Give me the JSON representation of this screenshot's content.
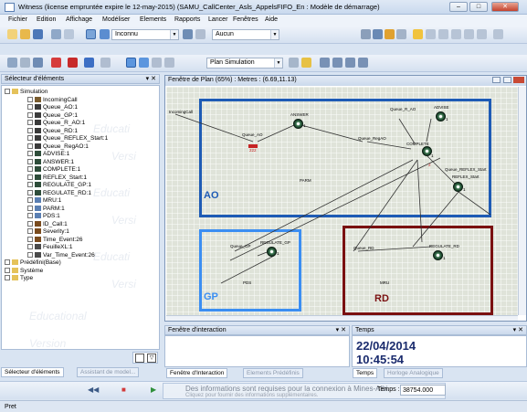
{
  "window": {
    "title": "Witness (license empruntée expire le 12-may-2015) (SAMU_CallCenter_Asls_AppelsFIFO_En : Modèle de démarrage)"
  },
  "menu": [
    "Fichier",
    "Edition",
    "Affichage",
    "Modéliser",
    "Elements",
    "Rapports",
    "Lancer",
    "Fenêtres",
    "Aide"
  ],
  "toolbar": {
    "combo1": "Inconnu",
    "combo2": "Aucun",
    "combo3": "Plan Simulation"
  },
  "element_selector": {
    "title": "Sélecteur d'éléments",
    "items": [
      {
        "label": "Simulation",
        "level": 0,
        "kind": "folder"
      },
      {
        "label": "IncomingCall",
        "level": 1,
        "kind": "entry"
      },
      {
        "label": "Queue_AO:1",
        "level": 1,
        "kind": "queue"
      },
      {
        "label": "Queue_GP:1",
        "level": 1,
        "kind": "queue"
      },
      {
        "label": "Queue_R_AO:1",
        "level": 1,
        "kind": "queue"
      },
      {
        "label": "Queue_RD:1",
        "level": 1,
        "kind": "queue"
      },
      {
        "label": "Queue_REFLEX_Start:1",
        "level": 1,
        "kind": "queue"
      },
      {
        "label": "Queue_RegAO:1",
        "level": 1,
        "kind": "queue"
      },
      {
        "label": "ADVISE:1",
        "level": 1,
        "kind": "machine"
      },
      {
        "label": "ANSWER:1",
        "level": 1,
        "kind": "machine"
      },
      {
        "label": "COMPLETE:1",
        "level": 1,
        "kind": "machine"
      },
      {
        "label": "REFLEX_Start:1",
        "level": 1,
        "kind": "machine"
      },
      {
        "label": "REGULATE_GP:1",
        "level": 1,
        "kind": "machine"
      },
      {
        "label": "REGULATE_RD:1",
        "level": 1,
        "kind": "machine"
      },
      {
        "label": "MRU:1",
        "level": 1,
        "kind": "labor"
      },
      {
        "label": "PARM:1",
        "level": 1,
        "kind": "labor"
      },
      {
        "label": "PDS:1",
        "level": 1,
        "kind": "labor"
      },
      {
        "label": "ID_Call:1",
        "level": 1,
        "kind": "attr"
      },
      {
        "label": "Severity:1",
        "level": 1,
        "kind": "attr"
      },
      {
        "label": "Time_Event:26",
        "level": 1,
        "kind": "attr"
      },
      {
        "label": "FeuilleXL:1",
        "level": 1,
        "kind": "file"
      },
      {
        "label": "Var_Time_Event:26",
        "level": 1,
        "kind": "file"
      },
      {
        "label": "Prédéfini(Base)",
        "level": 0,
        "kind": "folder"
      },
      {
        "label": "Système",
        "level": 0,
        "kind": "folder"
      },
      {
        "label": "Type",
        "level": 0,
        "kind": "folder"
      }
    ],
    "watermark": [
      "Educati",
      "Versi",
      "Educati",
      "Versi",
      "Educati",
      "Versi",
      "Educational",
      "Version"
    ]
  },
  "left_tabs": [
    "Sélecteur d'éléments",
    "Assistant de model..."
  ],
  "plan_window": {
    "title": "Fenêtre de Plan (65%) : Metres : (6.69,11.13)",
    "regions": [
      {
        "label": "AO",
        "color": "#1e5bb5"
      },
      {
        "label": "GP",
        "color": "#3b8ef2"
      },
      {
        "label": "RD",
        "color": "#7a1010"
      }
    ],
    "nodes": [
      "IncomingCall",
      "Queue_AO",
      "ANSWER",
      "Queue_R_AO",
      "ADVISE",
      "COMPLETE",
      "Queue_RegAO",
      "Queue_REFLEX_Start",
      "REFLEX_Start",
      "PARM",
      "Queue_GP",
      "REGULATE_GP",
      "PDS",
      "Queue_RD",
      "REGULATE_RD",
      "MRU"
    ],
    "values": {
      "queue_ao": "222",
      "n1": "1",
      "n2": "1",
      "n3": "1",
      "n4": "2",
      "n5": "1",
      "n6": "1",
      "n7": "1"
    }
  },
  "interaction": {
    "title": "Fenêtre d'interaction"
  },
  "temps": {
    "title": "Temps",
    "date": "22/04/2014",
    "time": "10:45:54",
    "value": "38754.000"
  },
  "bottom_tabs": [
    "Fenêtre d'Interaction",
    "Elements Prédéfinis",
    "Temps",
    "Horloge Analogique"
  ],
  "notification": {
    "line1": "Des informations sont requises pour la connexion à Mines-Albi.",
    "line2": "Cliquez pour fournir des informations supplémentaires."
  },
  "sim_bar": {
    "label": "Temps :"
  },
  "status": {
    "text": "Pret"
  }
}
